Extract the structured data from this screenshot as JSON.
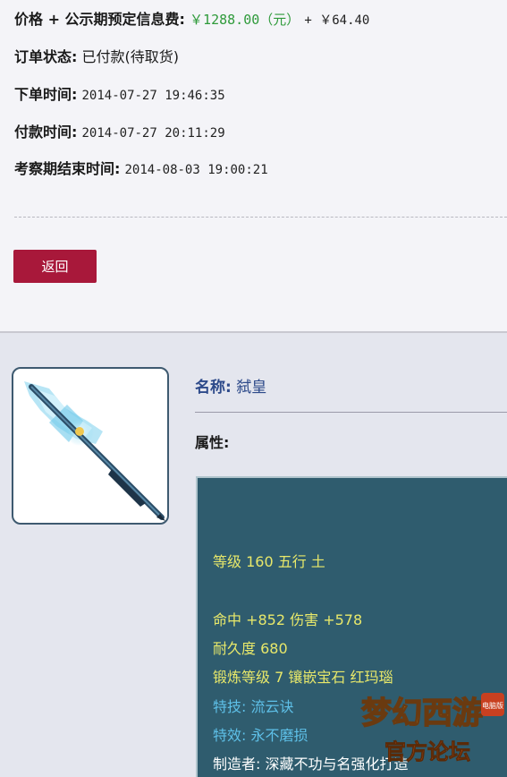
{
  "order": {
    "price_label": "价格 + 公示期预定信息费:",
    "price_value": "￥1288.00（元）",
    "fee_value": "+ ￥64.40",
    "status_label": "订单状态:",
    "status_value": "已付款(待取货)",
    "order_time_label": "下单时间:",
    "order_time_value": "2014-07-27 19:46:35",
    "pay_time_label": "付款时间:",
    "pay_time_value": "2014-07-27 20:11:29",
    "inspect_end_label": "考察期结束时间:",
    "inspect_end_value": "2014-08-03 19:00:21",
    "back_button": "返回"
  },
  "item": {
    "name_label": "名称:",
    "name_value": "弑皇",
    "attr_label": "属性:",
    "stats": {
      "level_line": "等级 160 五行 土",
      "hit_damage_line": "命中 +852 伤害 +578",
      "durability_line": "耐久度 680",
      "forge_line": "锻炼等级 7 镶嵌宝石 红玛瑙",
      "skill_line": "特技: 流云诀",
      "effect_line": "特效: 永不磨损",
      "maker_line": "制造者: 深藏不功与名强化打造"
    }
  },
  "watermark": {
    "line1": "梦幻西游",
    "line2": "官方论坛",
    "badge": "电脑版"
  },
  "colors": {
    "back_button_bg": "#a8183a",
    "stat_panel_bg": "#2f5c6e",
    "stat_yellow": "#e8e86a",
    "stat_cyan": "#5ec0e8",
    "price_green": "#2e9a3a",
    "name_blue": "#2d4a8a"
  }
}
